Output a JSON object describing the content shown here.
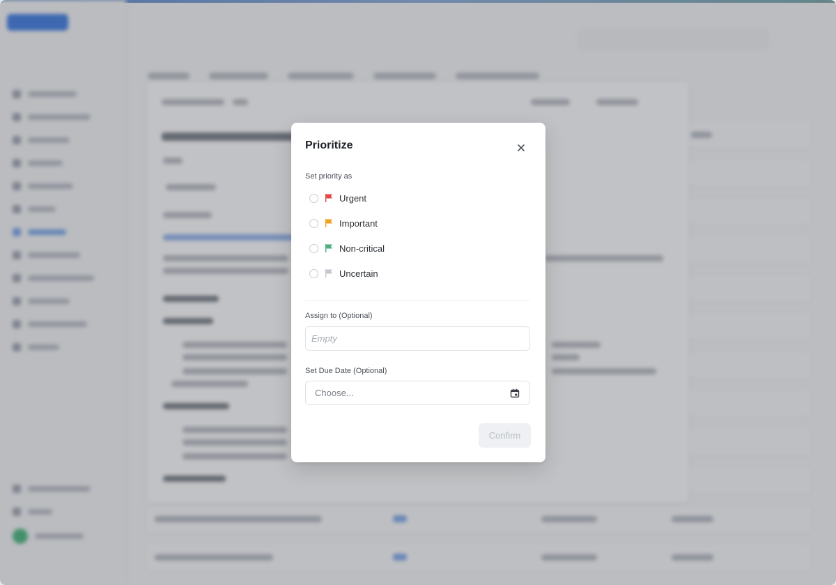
{
  "modal": {
    "title": "Prioritize",
    "priority_label": "Set priority as",
    "options": [
      {
        "label": "Urgent",
        "flag_color": "#e04646"
      },
      {
        "label": "Important",
        "flag_color": "#f0a21b"
      },
      {
        "label": "Non-critical",
        "flag_color": "#4caf7f"
      },
      {
        "label": "Uncertain",
        "flag_color": "#c3c7ce"
      }
    ],
    "assign_label": "Assign to (Optional)",
    "assign_placeholder": "Empty",
    "due_date_label": "Set Due Date (Optional)",
    "due_date_placeholder": "Choose...",
    "confirm_label": "Confirm"
  },
  "icons": {
    "close": "close-icon",
    "calendar": "calendar-icon",
    "flag": "flag-icon"
  },
  "colors": {
    "accent": "#3f7be0",
    "confirm_disabled_bg": "#eef0f3",
    "confirm_disabled_text": "#b9bdc4"
  }
}
